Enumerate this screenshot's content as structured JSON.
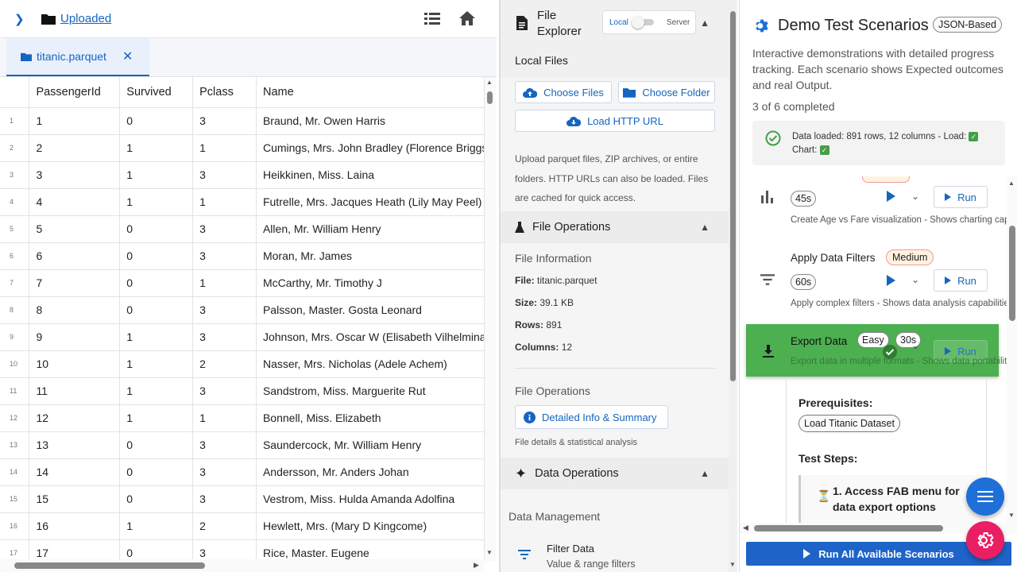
{
  "left": {
    "breadcrumb": "Uploaded",
    "tab_name": "titanic.parquet",
    "tab_close": "✕",
    "columns": [
      "PassengerId",
      "Survived",
      "Pclass",
      "Name"
    ],
    "rows": [
      [
        "1",
        "1",
        "0",
        "3",
        "Braund, Mr. Owen Harris"
      ],
      [
        "2",
        "2",
        "1",
        "1",
        "Cumings, Mrs. John Bradley (Florence Briggs Th"
      ],
      [
        "3",
        "3",
        "1",
        "3",
        "Heikkinen, Miss. Laina"
      ],
      [
        "4",
        "4",
        "1",
        "1",
        "Futrelle, Mrs. Jacques Heath (Lily May Peel)"
      ],
      [
        "5",
        "5",
        "0",
        "3",
        "Allen, Mr. William Henry"
      ],
      [
        "6",
        "6",
        "0",
        "3",
        "Moran, Mr. James"
      ],
      [
        "7",
        "7",
        "0",
        "1",
        "McCarthy, Mr. Timothy J"
      ],
      [
        "8",
        "8",
        "0",
        "3",
        "Palsson, Master. Gosta Leonard"
      ],
      [
        "9",
        "9",
        "1",
        "3",
        "Johnson, Mrs. Oscar W (Elisabeth Vilhelmina Be"
      ],
      [
        "10",
        "10",
        "1",
        "2",
        "Nasser, Mrs. Nicholas (Adele Achem)"
      ],
      [
        "11",
        "11",
        "1",
        "3",
        "Sandstrom, Miss. Marguerite Rut"
      ],
      [
        "12",
        "12",
        "1",
        "1",
        "Bonnell, Miss. Elizabeth"
      ],
      [
        "13",
        "13",
        "0",
        "3",
        "Saundercock, Mr. William Henry"
      ],
      [
        "14",
        "14",
        "0",
        "3",
        "Andersson, Mr. Anders Johan"
      ],
      [
        "15",
        "15",
        "0",
        "3",
        "Vestrom, Miss. Hulda Amanda Adolfina"
      ],
      [
        "16",
        "16",
        "1",
        "2",
        "Hewlett, Mrs. (Mary D Kingcome)"
      ],
      [
        "17",
        "17",
        "0",
        "3",
        "Rice, Master. Eugene"
      ]
    ]
  },
  "mid": {
    "title": "File Explorer",
    "toggle_local": "Local",
    "toggle_server": "Server",
    "local_files": "Local Files",
    "choose_files": "Choose Files",
    "choose_folder": "Choose Folder",
    "load_http": "Load HTTP URL",
    "upload_help": "Upload parquet files, ZIP archives, or entire folders. HTTP URLs can also be loaded. Files are cached for quick access.",
    "file_ops_header": "File Operations",
    "file_info_title": "File Information",
    "file_label": "File:",
    "file_value": "titanic.parquet",
    "size_label": "Size:",
    "size_value": "39.1 KB",
    "rows_label": "Rows:",
    "rows_value": "891",
    "cols_label": "Columns:",
    "cols_value": "12",
    "file_ops_sub": "File Operations",
    "detailed_info": "Detailed Info & Summary",
    "detailed_info_desc": "File details & statistical analysis",
    "data_ops_header": "Data Operations",
    "data_mgmt": "Data Management",
    "filter_title": "Filter Data",
    "filter_desc": "Value & range filters"
  },
  "right": {
    "title": "Demo Test Scenarios",
    "badge": "JSON-Based",
    "desc": "Interactive demonstrations with detailed progress tracking. Each scenario shows Expected outcomes and real Output.",
    "count": "3 of 6 completed",
    "status": "Data loaded: 891 rows, 12 columns - Load:",
    "status_chart": "Chart:",
    "s1_dur": "45s",
    "s1_desc": "Create Age vs Fare visualization - Shows charting capabilities",
    "s2_title": "Apply Data Filters",
    "s2_diff": "Medium",
    "s2_dur": "60s",
    "s2_desc": "Apply complex filters - Shows data analysis capabilities",
    "s3_title": "Export Data",
    "s3_diff": "Easy",
    "s3_dur": "30s",
    "s3_desc": "Export data in multiple formats - Shows data portability",
    "run": "Run",
    "prereq": "Prerequisites:",
    "prereq_item": "Load Titanic Dataset",
    "steps": "Test Steps:",
    "step1": "1. Access FAB menu for data export options",
    "run_all": "Run All Available Scenarios"
  },
  "colors": {
    "accent": "#1565c0",
    "success": "#4caf50",
    "fab_pink": "#e91e63"
  }
}
